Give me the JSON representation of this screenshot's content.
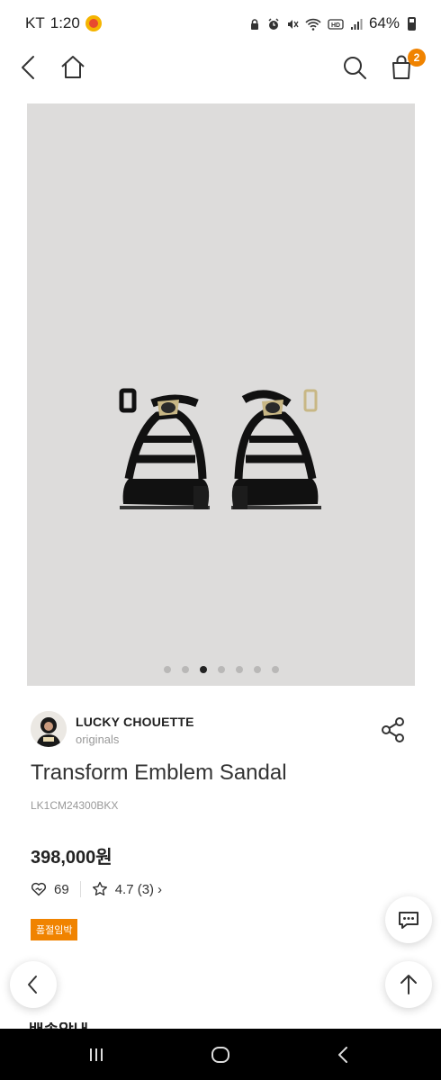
{
  "status_bar": {
    "carrier": "KT",
    "time": "1:20",
    "battery": "64%",
    "icons": [
      "carrier-app-icon",
      "lock-icon",
      "alarm-icon",
      "mute-icon",
      "wifi-icon",
      "hd-icon",
      "signal-icon",
      "battery-icon"
    ]
  },
  "top_nav": {
    "cart_count": "2",
    "icons": [
      "back-icon",
      "home-icon",
      "search-icon",
      "shopping-bag-icon"
    ]
  },
  "gallery": {
    "total_slides": 7,
    "active_slide": 3
  },
  "brand": {
    "name": "LUCKY CHOUETTE",
    "subtitle": "originals"
  },
  "product": {
    "name": "Transform Emblem Sandal",
    "code": "LK1CM24300BKX",
    "price": "398,000원",
    "likes": "69",
    "rating": "4.7 (3)",
    "status_badge": "품절임박"
  },
  "partial_heading": "배송안내",
  "colors": {
    "accent": "#f08300",
    "image_bg": "#dddcdb",
    "text": "#222222",
    "muted": "#999999"
  },
  "floating_buttons": [
    "chat-icon",
    "prev-icon",
    "scroll-top-icon"
  ],
  "system_nav": [
    "recents-icon",
    "home-circle-icon",
    "back-chevron-icon"
  ]
}
